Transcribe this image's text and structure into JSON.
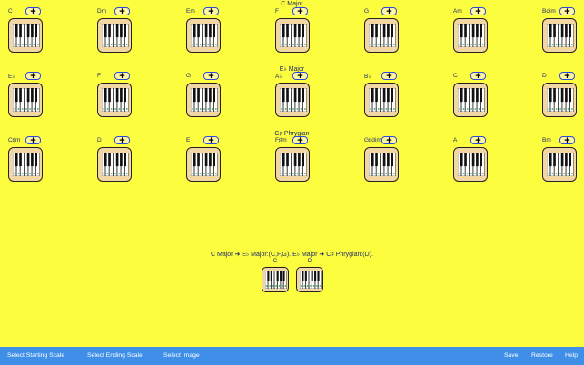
{
  "scales": [
    {
      "title": "C Major",
      "chords": [
        "C",
        "Dm",
        "Em",
        "F",
        "G",
        "Am",
        "Bdim"
      ]
    },
    {
      "title": "E♭ Major",
      "chords": [
        "E♭",
        "F",
        "G",
        "A♭",
        "B♭",
        "C",
        "D"
      ]
    },
    {
      "title": "C♯ Phrygian",
      "chords": [
        "C♯m",
        "D",
        "E",
        "F♯m",
        "G♯dim",
        "A",
        "Bm"
      ]
    }
  ],
  "add_button_symbol": "+",
  "progression": {
    "text": "C Major  ➜  E♭ Major:(C,F,G). E♭ Major  ➜  C♯ Phrygian:(D).",
    "chords": [
      "C",
      "D"
    ]
  },
  "toolbar": {
    "select_starting_scale": "Select Starting Scale",
    "select_ending_scale": "Select Ending Scale",
    "select_image": "Select Image",
    "save": "Save",
    "restore": "Restore",
    "help": "Help"
  },
  "colors": {
    "background": "#fdfd3f",
    "toolbar": "#3f8ee8",
    "button_border": "#2b4bd6",
    "piano_body": "#f3d7a3"
  }
}
